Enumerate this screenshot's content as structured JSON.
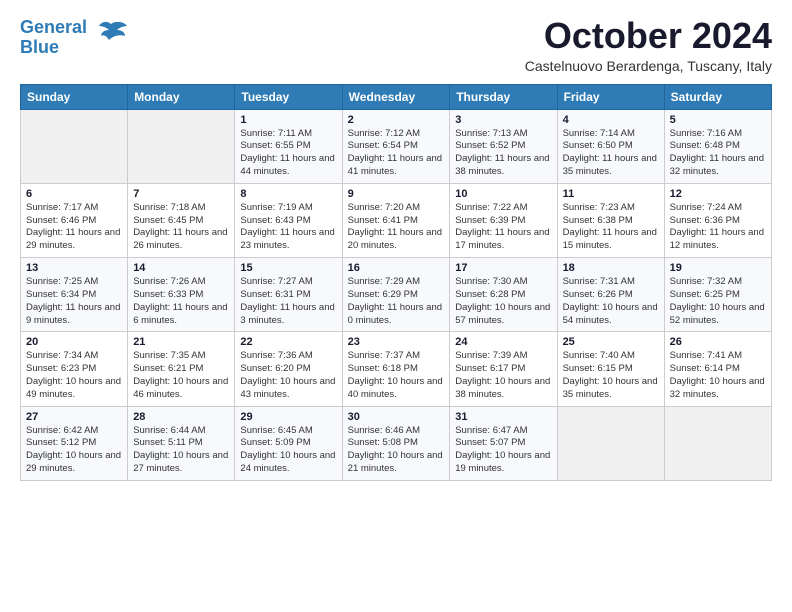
{
  "header": {
    "logo_line1": "General",
    "logo_line2": "Blue",
    "month_title": "October 2024",
    "location": "Castelnuovo Berardenga, Tuscany, Italy"
  },
  "weekdays": [
    "Sunday",
    "Monday",
    "Tuesday",
    "Wednesday",
    "Thursday",
    "Friday",
    "Saturday"
  ],
  "weeks": [
    [
      {
        "day": "",
        "info": ""
      },
      {
        "day": "",
        "info": ""
      },
      {
        "day": "1",
        "info": "Sunrise: 7:11 AM\nSunset: 6:55 PM\nDaylight: 11 hours and 44 minutes."
      },
      {
        "day": "2",
        "info": "Sunrise: 7:12 AM\nSunset: 6:54 PM\nDaylight: 11 hours and 41 minutes."
      },
      {
        "day": "3",
        "info": "Sunrise: 7:13 AM\nSunset: 6:52 PM\nDaylight: 11 hours and 38 minutes."
      },
      {
        "day": "4",
        "info": "Sunrise: 7:14 AM\nSunset: 6:50 PM\nDaylight: 11 hours and 35 minutes."
      },
      {
        "day": "5",
        "info": "Sunrise: 7:16 AM\nSunset: 6:48 PM\nDaylight: 11 hours and 32 minutes."
      }
    ],
    [
      {
        "day": "6",
        "info": "Sunrise: 7:17 AM\nSunset: 6:46 PM\nDaylight: 11 hours and 29 minutes."
      },
      {
        "day": "7",
        "info": "Sunrise: 7:18 AM\nSunset: 6:45 PM\nDaylight: 11 hours and 26 minutes."
      },
      {
        "day": "8",
        "info": "Sunrise: 7:19 AM\nSunset: 6:43 PM\nDaylight: 11 hours and 23 minutes."
      },
      {
        "day": "9",
        "info": "Sunrise: 7:20 AM\nSunset: 6:41 PM\nDaylight: 11 hours and 20 minutes."
      },
      {
        "day": "10",
        "info": "Sunrise: 7:22 AM\nSunset: 6:39 PM\nDaylight: 11 hours and 17 minutes."
      },
      {
        "day": "11",
        "info": "Sunrise: 7:23 AM\nSunset: 6:38 PM\nDaylight: 11 hours and 15 minutes."
      },
      {
        "day": "12",
        "info": "Sunrise: 7:24 AM\nSunset: 6:36 PM\nDaylight: 11 hours and 12 minutes."
      }
    ],
    [
      {
        "day": "13",
        "info": "Sunrise: 7:25 AM\nSunset: 6:34 PM\nDaylight: 11 hours and 9 minutes."
      },
      {
        "day": "14",
        "info": "Sunrise: 7:26 AM\nSunset: 6:33 PM\nDaylight: 11 hours and 6 minutes."
      },
      {
        "day": "15",
        "info": "Sunrise: 7:27 AM\nSunset: 6:31 PM\nDaylight: 11 hours and 3 minutes."
      },
      {
        "day": "16",
        "info": "Sunrise: 7:29 AM\nSunset: 6:29 PM\nDaylight: 11 hours and 0 minutes."
      },
      {
        "day": "17",
        "info": "Sunrise: 7:30 AM\nSunset: 6:28 PM\nDaylight: 10 hours and 57 minutes."
      },
      {
        "day": "18",
        "info": "Sunrise: 7:31 AM\nSunset: 6:26 PM\nDaylight: 10 hours and 54 minutes."
      },
      {
        "day": "19",
        "info": "Sunrise: 7:32 AM\nSunset: 6:25 PM\nDaylight: 10 hours and 52 minutes."
      }
    ],
    [
      {
        "day": "20",
        "info": "Sunrise: 7:34 AM\nSunset: 6:23 PM\nDaylight: 10 hours and 49 minutes."
      },
      {
        "day": "21",
        "info": "Sunrise: 7:35 AM\nSunset: 6:21 PM\nDaylight: 10 hours and 46 minutes."
      },
      {
        "day": "22",
        "info": "Sunrise: 7:36 AM\nSunset: 6:20 PM\nDaylight: 10 hours and 43 minutes."
      },
      {
        "day": "23",
        "info": "Sunrise: 7:37 AM\nSunset: 6:18 PM\nDaylight: 10 hours and 40 minutes."
      },
      {
        "day": "24",
        "info": "Sunrise: 7:39 AM\nSunset: 6:17 PM\nDaylight: 10 hours and 38 minutes."
      },
      {
        "day": "25",
        "info": "Sunrise: 7:40 AM\nSunset: 6:15 PM\nDaylight: 10 hours and 35 minutes."
      },
      {
        "day": "26",
        "info": "Sunrise: 7:41 AM\nSunset: 6:14 PM\nDaylight: 10 hours and 32 minutes."
      }
    ],
    [
      {
        "day": "27",
        "info": "Sunrise: 6:42 AM\nSunset: 5:12 PM\nDaylight: 10 hours and 29 minutes."
      },
      {
        "day": "28",
        "info": "Sunrise: 6:44 AM\nSunset: 5:11 PM\nDaylight: 10 hours and 27 minutes."
      },
      {
        "day": "29",
        "info": "Sunrise: 6:45 AM\nSunset: 5:09 PM\nDaylight: 10 hours and 24 minutes."
      },
      {
        "day": "30",
        "info": "Sunrise: 6:46 AM\nSunset: 5:08 PM\nDaylight: 10 hours and 21 minutes."
      },
      {
        "day": "31",
        "info": "Sunrise: 6:47 AM\nSunset: 5:07 PM\nDaylight: 10 hours and 19 minutes."
      },
      {
        "day": "",
        "info": ""
      },
      {
        "day": "",
        "info": ""
      }
    ]
  ]
}
